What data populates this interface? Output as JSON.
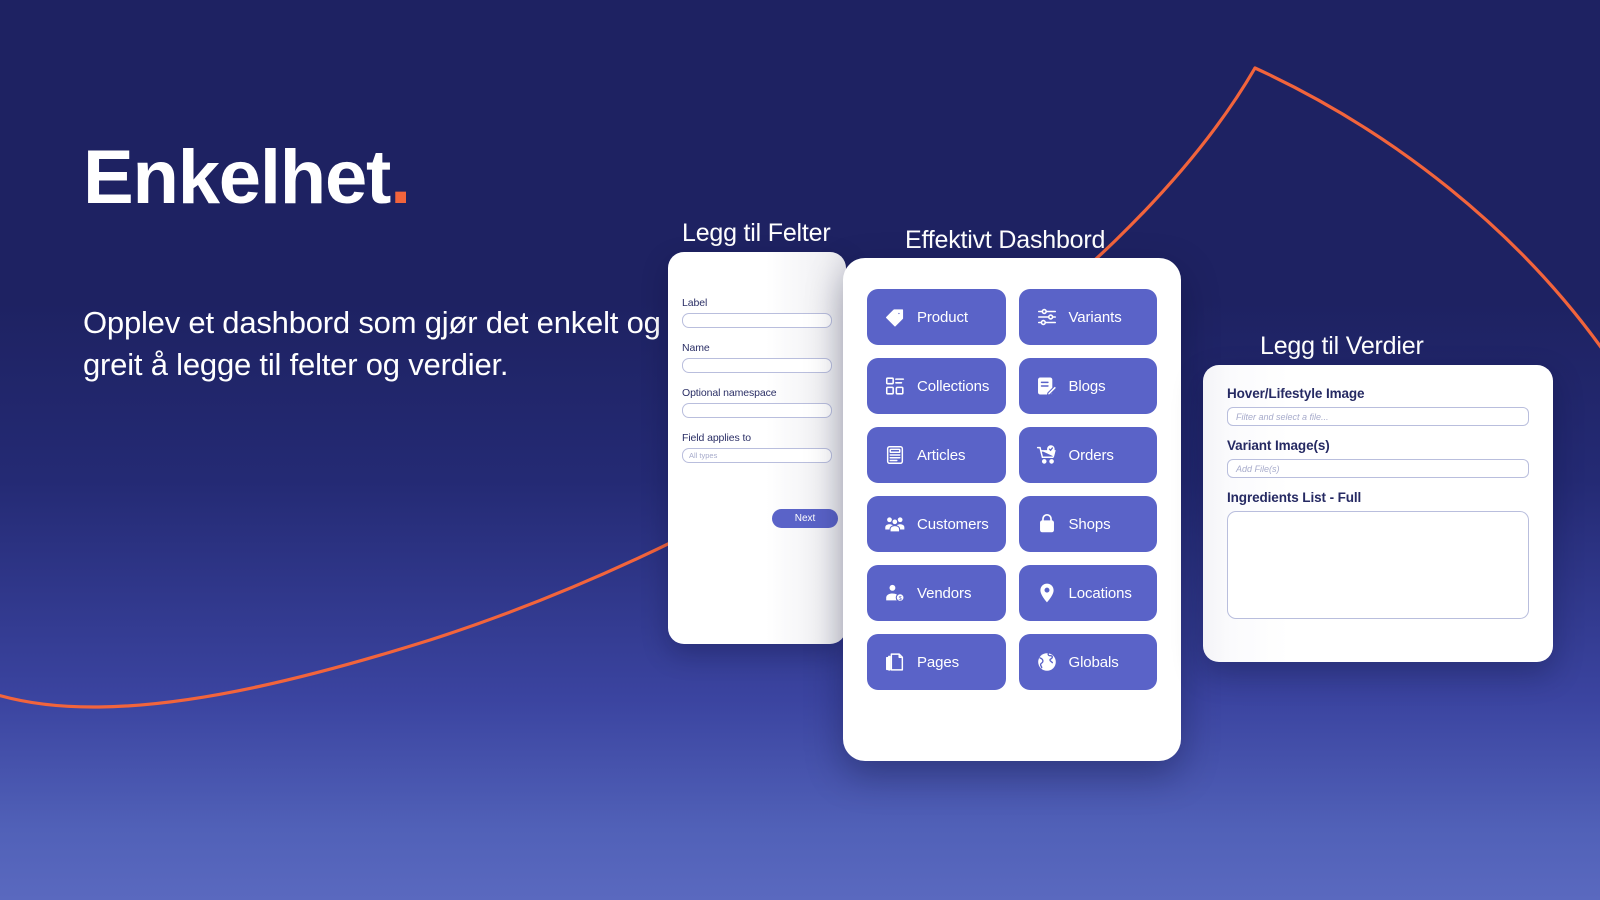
{
  "hero": {
    "title": "Enkelhet",
    "title_dot": ".",
    "subtitle": "Opplev et dashbord som gjør det enkelt og greit å legge til felter og verdier."
  },
  "colors": {
    "background_top": "#1e2262",
    "background_bottom": "#5a69bf",
    "accent_orange": "#f2643c",
    "button_purple": "#5a63c8",
    "card_white": "#ffffff",
    "label_navy": "#262a63",
    "input_border": "#b9bedd"
  },
  "card_fields": {
    "title": "Legg til Felter",
    "fields": [
      {
        "label": "Label",
        "value": "",
        "placeholder": ""
      },
      {
        "label": "Name",
        "value": "",
        "placeholder": ""
      },
      {
        "label": "Optional namespace",
        "value": "",
        "placeholder": ""
      },
      {
        "label": "Field applies to",
        "value": "",
        "placeholder": "All types"
      }
    ],
    "next_label": "Next"
  },
  "card_dashboard": {
    "title": "Effektivt Dashbord",
    "buttons": [
      {
        "label": "Product",
        "icon": "tag-icon"
      },
      {
        "label": "Variants",
        "icon": "sliders-icon"
      },
      {
        "label": "Collections",
        "icon": "grid-layout-icon"
      },
      {
        "label": "Blogs",
        "icon": "document-pencil-icon"
      },
      {
        "label": "Articles",
        "icon": "article-lines-icon"
      },
      {
        "label": "Orders",
        "icon": "shopping-cart-check-icon"
      },
      {
        "label": "Customers",
        "icon": "people-group-icon"
      },
      {
        "label": "Shops",
        "icon": "shopping-bag-icon"
      },
      {
        "label": "Vendors",
        "icon": "person-money-icon"
      },
      {
        "label": "Locations",
        "icon": "map-pin-icon"
      },
      {
        "label": "Pages",
        "icon": "pages-stack-icon"
      },
      {
        "label": "Globals",
        "icon": "globe-icon"
      }
    ]
  },
  "card_values": {
    "title": "Legg til Verdier",
    "fields": [
      {
        "label": "Hover/Lifestyle Image",
        "type": "input",
        "value": "",
        "placeholder": "Filter and select a file..."
      },
      {
        "label": "Variant Image(s)",
        "type": "input",
        "value": "",
        "placeholder": "Add File(s)"
      },
      {
        "label": "Ingredients List - Full",
        "type": "textarea",
        "value": "",
        "placeholder": ""
      }
    ]
  }
}
